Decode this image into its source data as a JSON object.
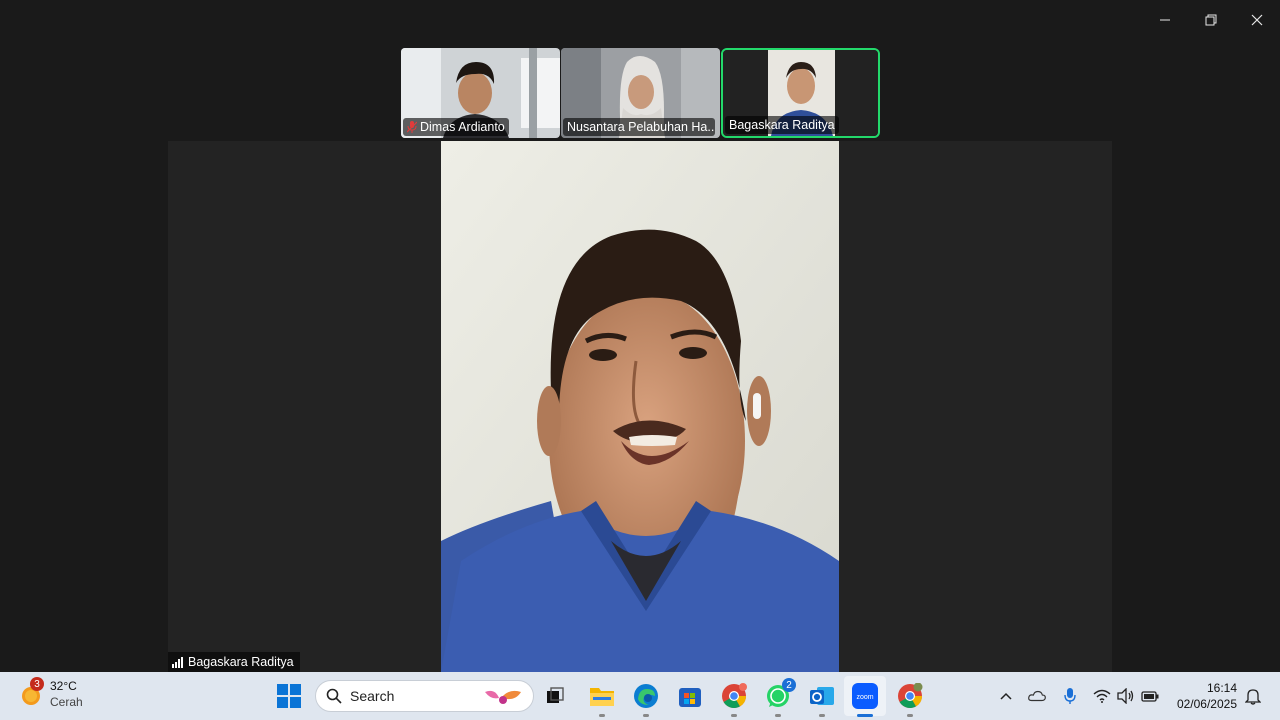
{
  "window": {
    "minimize": "minimize-icon",
    "restore": "restore-icon",
    "close": "close-icon"
  },
  "participants": [
    {
      "name": "Dimas Ardianto",
      "muted": true
    },
    {
      "name": "Nusantara Pelabuhan Ha...",
      "muted": false
    },
    {
      "name": "Bagaskara Raditya",
      "muted": false,
      "active": true
    }
  ],
  "main_speaker": {
    "name": "Bagaskara Raditya"
  },
  "colors": {
    "active_border": "#23d96b",
    "taskbar": "#dfe6ef",
    "accent": "#1a6fd6"
  },
  "taskbar": {
    "weather": {
      "temp": "32°C",
      "condition": "Cerah",
      "badge": "3"
    },
    "search": {
      "label": "Search"
    },
    "apps": [
      {
        "name": "task-view-icon"
      },
      {
        "name": "file-explorer-icon"
      },
      {
        "name": "edge-icon"
      },
      {
        "name": "microsoft-store-icon"
      },
      {
        "name": "chrome-icon"
      },
      {
        "name": "whatsapp-icon",
        "badge": "2"
      },
      {
        "name": "outlook-icon"
      },
      {
        "name": "zoom-icon",
        "label": "zoom"
      },
      {
        "name": "chrome-profile-icon"
      }
    ],
    "tray": [
      "chevron-up-icon",
      "onedrive-icon",
      "microphone-icon",
      "wifi-icon",
      "volume-icon",
      "battery-icon"
    ],
    "clock": {
      "time": "16:14",
      "date": "02/06/2025"
    },
    "notifications": "notification-bell-icon"
  }
}
